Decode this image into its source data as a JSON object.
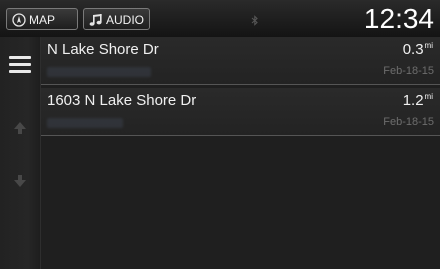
{
  "header": {
    "map_label": "MAP",
    "audio_label": "AUDIO",
    "clock": "12:34"
  },
  "list": {
    "items": [
      {
        "title": "N Lake Shore Dr",
        "distance": "0.3",
        "unit": "mi",
        "date": "Feb-18-15"
      },
      {
        "title": "1603 N Lake Shore Dr",
        "distance": "1.2",
        "unit": "mi",
        "date": "Feb-18-15"
      }
    ]
  },
  "icons": {
    "map": "compass-icon",
    "audio": "music-note-icon",
    "status": "bluetooth-icon",
    "menu": "hamburger-menu-icon",
    "scroll_up": "arrow-up-icon",
    "scroll_down": "arrow-down-icon"
  },
  "colors": {
    "background": "#1b1b1b",
    "text": "#f0f0f0",
    "divider": "#555555"
  }
}
